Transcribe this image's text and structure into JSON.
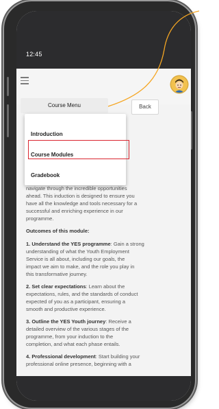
{
  "status": {
    "time": "12:45"
  },
  "header": {
    "menu_icon": "hamburger-icon",
    "avatar_icon": "avatar"
  },
  "toolbar": {
    "course_menu_label": "Course Menu",
    "back_label": "Back"
  },
  "dropdown": {
    "items": [
      {
        "label": "Introduction"
      },
      {
        "label": "Course Modules"
      },
      {
        "label": "Gradebook"
      }
    ],
    "highlighted": "Course Modules"
  },
  "content": {
    "intro_lines": [
      "navigate through the incredible opportunities",
      "ahead. This induction is designed to ensure you",
      "have all the knowledge and tools necessary for a",
      "successful and enriching experience in our",
      "programme."
    ],
    "outcomes_heading": "Outcomes of this module:",
    "items": [
      {
        "title": "1. Understand the YES programme",
        "lines": [
          ": Gain a strong",
          "understanding of what the Youth Employment",
          "Service is all about, including our goals, the",
          "impact we aim to make, and the role you play in",
          "this transformative journey."
        ]
      },
      {
        "title": "2. Set clear expectations",
        "lines": [
          ": Learn about the",
          "expectations, rules, and the standards of conduct",
          "expected of you as a participant, ensuring a",
          "smooth and productive experience."
        ]
      },
      {
        "title": "3. Outline the YES Youth journey",
        "lines": [
          ": Receive a",
          "detailed overview of the various stages of the",
          "programme, from your induction to the",
          "completion, and what each phase entails."
        ]
      },
      {
        "title": "4. Professional development",
        "lines": [
          ": Start building your",
          "professional online presence, beginning with a"
        ]
      }
    ]
  },
  "colors": {
    "highlight_border": "#d9252f",
    "annotation_line": "#f5a623"
  }
}
